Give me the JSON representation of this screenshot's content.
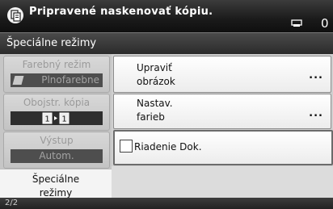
{
  "status": {
    "message": "Pripravené naskenovať kópiu.",
    "count": "0",
    "icons": [
      "copy-document-icon",
      "paper-tray-icon"
    ]
  },
  "title": "Špeciálne režimy",
  "left": {
    "color_mode": {
      "label": "Farebný režim",
      "value": "Plnofarebne"
    },
    "duplex": {
      "label": "Obojstr. kópia",
      "value": "1▸1"
    },
    "output": {
      "label": "Výstup",
      "value": "Autom."
    },
    "special_tab": {
      "line1": "Špeciálne",
      "line2": "režimy"
    }
  },
  "right": {
    "image_edit": {
      "line1": "Upraviť",
      "line2": "obrázok",
      "more": "..."
    },
    "color_adjust": {
      "line1": "Nastav.",
      "line2": "farieb",
      "more": "..."
    },
    "doc_control": {
      "label": "Riadenie Dok.",
      "checked": false
    }
  },
  "footer": {
    "page": "2/2"
  },
  "colors": {
    "bar": "#1a1a1a",
    "panel": "#d0d0d0",
    "button": "#ffffff"
  }
}
